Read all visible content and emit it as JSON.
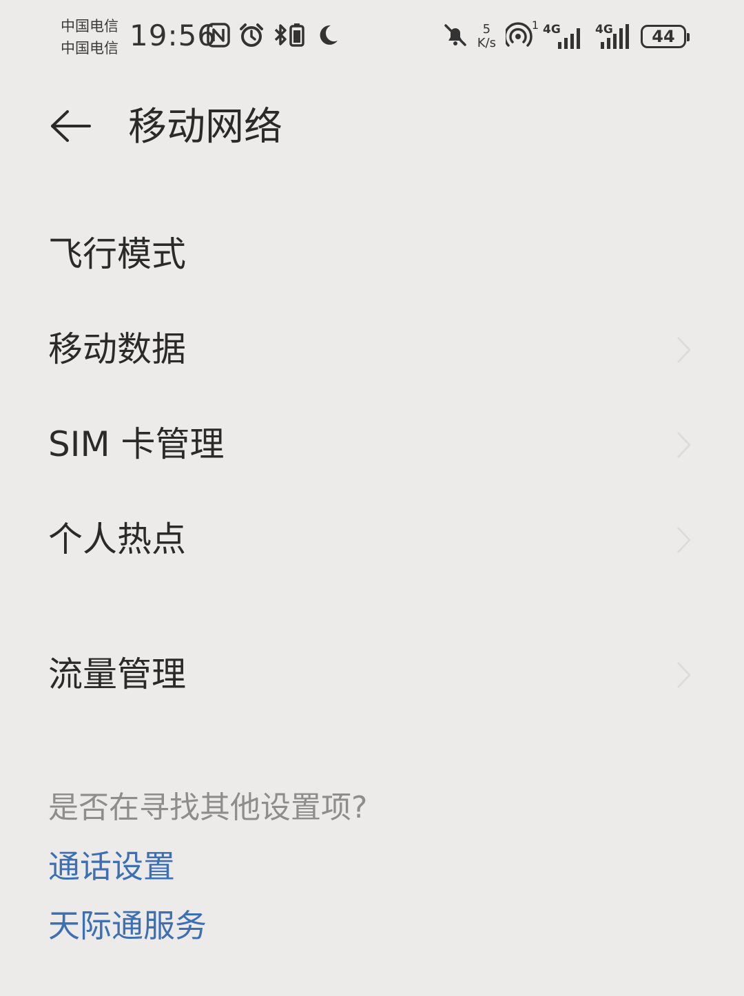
{
  "status_bar": {
    "carrier_1": "中国电信",
    "carrier_2": "中国电信",
    "time": "19:56",
    "net_speed_value": "5",
    "net_speed_unit": "K/s",
    "hotspot_count": "1",
    "sim1_network": "4G",
    "sim2_network": "4G",
    "battery_level": "44",
    "icons": [
      "nfc-icon",
      "alarm-icon",
      "bluetooth-icon",
      "moon-icon",
      "mute-bell-icon",
      "hotspot-icon",
      "signal-icon",
      "battery-icon"
    ]
  },
  "header": {
    "title": "移动网络"
  },
  "settings": {
    "items": [
      {
        "label": "飞行模式",
        "has_chevron": false
      },
      {
        "label": "移动数据",
        "has_chevron": true
      },
      {
        "label": "SIM 卡管理",
        "has_chevron": true
      },
      {
        "label": "个人热点",
        "has_chevron": true
      },
      {
        "label": "流量管理",
        "has_chevron": true
      }
    ]
  },
  "suggestions": {
    "title": "是否在寻找其他设置项?",
    "links": [
      "通话设置",
      "天际通服务"
    ]
  },
  "colors": {
    "background": "#ecebe9",
    "text_primary": "#2a2a2a",
    "text_secondary": "#8d8d8d",
    "link": "#3d6fb5"
  }
}
